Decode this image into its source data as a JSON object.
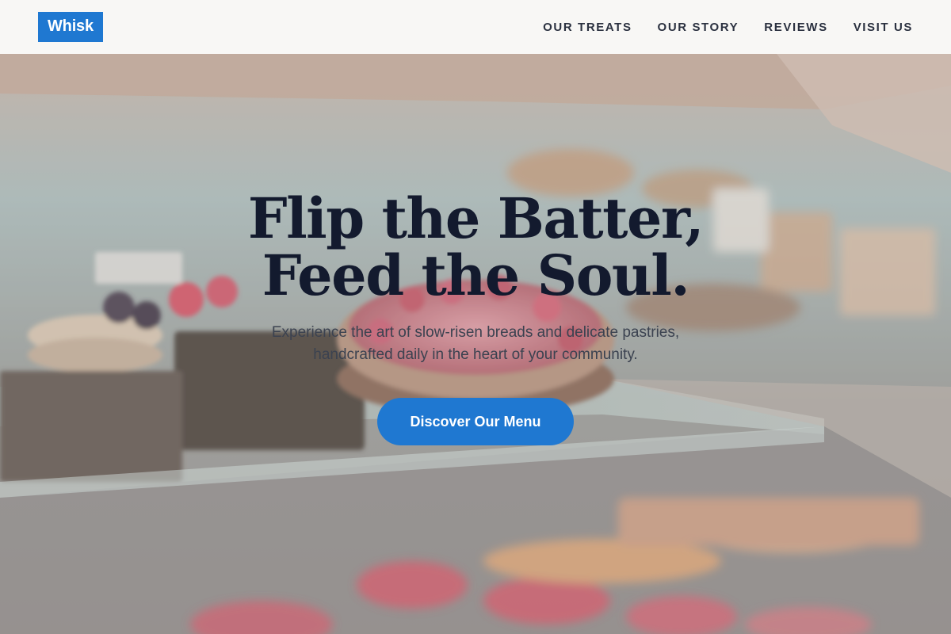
{
  "header": {
    "logo": "Whisk",
    "nav": [
      {
        "label": "OUR TREATS"
      },
      {
        "label": "OUR STORY"
      },
      {
        "label": "REVIEWS"
      },
      {
        "label": "VISIT US"
      }
    ]
  },
  "hero": {
    "headline_line1": "Flip the Batter,",
    "headline_line2": "Feed the Soul.",
    "subtitle_line1": "Experience the art of slow-risen breads and delicate pastries,",
    "subtitle_line2": "handcrafted daily in the heart of your community.",
    "cta_label": "Discover Our Menu"
  },
  "colors": {
    "accent": "#1f78d1",
    "headline": "#131a2e",
    "nav_text": "#2b3140",
    "header_bg": "#f8f7f6"
  }
}
